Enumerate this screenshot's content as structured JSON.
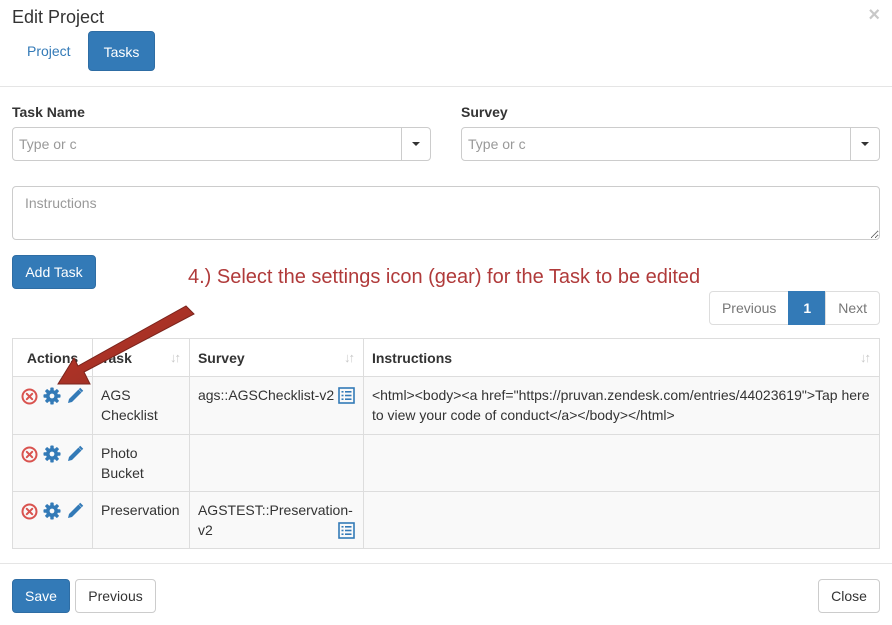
{
  "modal": {
    "title": "Edit Project",
    "close": "×"
  },
  "tabs": [
    {
      "label": "Project",
      "active": false
    },
    {
      "label": "Tasks",
      "active": true
    }
  ],
  "form": {
    "task_name_label": "Task Name",
    "task_name_placeholder": "Type or c",
    "survey_label": "Survey",
    "survey_placeholder": "Type or c",
    "instructions_placeholder": "Instructions",
    "add_task_label": "Add Task"
  },
  "annotation": {
    "text": "4.) Select the settings icon (gear) for the Task to be edited",
    "color": "#b03a3a"
  },
  "pagination": {
    "previous": "Previous",
    "current": "1",
    "next": "Next"
  },
  "table": {
    "headers": [
      "Actions",
      "Task",
      "Survey",
      "Instructions"
    ],
    "rows": [
      {
        "task": "AGS Checklist",
        "survey": "ags::AGSChecklist-v2",
        "instructions": "<html><body><a href=\"https://pruvan.zendesk.com/entries/44023619\">Tap here to view your code of conduct</a></body></html>",
        "icons": [
          "delete-icon",
          "gear-icon",
          "pencil-icon",
          "list-icon"
        ]
      },
      {
        "task": "Photo Bucket",
        "survey": "",
        "instructions": "",
        "icons": [
          "delete-icon",
          "gear-icon",
          "pencil-icon"
        ]
      },
      {
        "task": "Preservation",
        "survey": "AGSTEST::Preservation-v2",
        "instructions": "",
        "icons": [
          "delete-icon",
          "gear-icon",
          "pencil-icon",
          "list-icon"
        ]
      }
    ]
  },
  "footer": {
    "save": "Save",
    "previous": "Previous",
    "close": "Close"
  },
  "colors": {
    "primary": "#337ab7",
    "danger": "#d9534f",
    "annotation": "#b03a3a"
  }
}
